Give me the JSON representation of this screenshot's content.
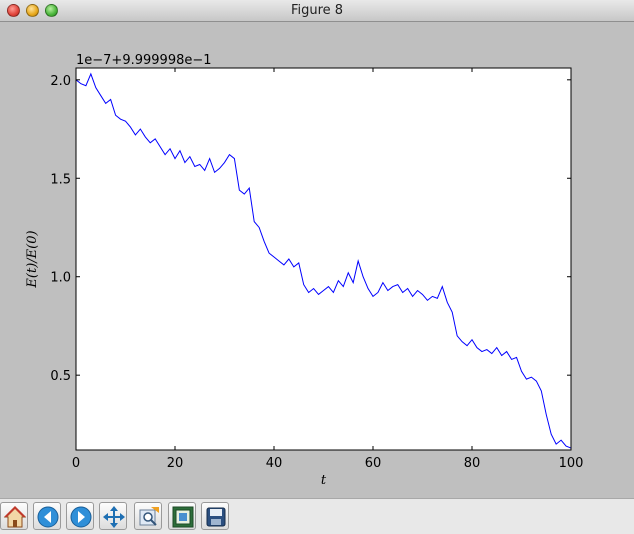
{
  "window": {
    "title": "Figure 8"
  },
  "toolbar": {
    "buttons": [
      {
        "icon": "home-icon"
      },
      {
        "icon": "back-icon"
      },
      {
        "icon": "forward-icon"
      },
      {
        "icon": "pan-icon"
      },
      {
        "icon": "zoom-rect-icon"
      },
      {
        "icon": "configure-subplots-icon"
      },
      {
        "icon": "save-icon"
      }
    ]
  },
  "colors": {
    "line": "#0000ff",
    "axes_bg": "#ffffff",
    "figure_bg": "#bfbfbf"
  },
  "chart_data": {
    "type": "line",
    "offset_label": "1e−7+9.999998e−1",
    "xlabel": "t",
    "ylabel": "E(t)/E(0)",
    "xlim": [
      0,
      100
    ],
    "ylim": [
      0.12,
      2.06
    ],
    "xticks": [
      0,
      20,
      40,
      60,
      80,
      100
    ],
    "yticks": [
      0.5,
      1.0,
      1.5,
      2.0
    ],
    "xtick_labels": [
      "0",
      "20",
      "40",
      "60",
      "80",
      "100"
    ],
    "ytick_labels": [
      "0.5",
      "1.0",
      "1.5",
      "2.0"
    ],
    "grid": false,
    "series": [
      {
        "x": [
          0,
          1,
          2,
          3,
          4,
          5,
          6,
          7,
          8,
          9,
          10,
          11,
          12,
          13,
          14,
          15,
          16,
          17,
          18,
          19,
          20,
          21,
          22,
          23,
          24,
          25,
          26,
          27,
          28,
          29,
          30,
          31,
          32,
          33,
          34,
          35,
          36,
          37,
          38,
          39,
          40,
          41,
          42,
          43,
          44,
          45,
          46,
          47,
          48,
          49,
          50,
          51,
          52,
          53,
          54,
          55,
          56,
          57,
          58,
          59,
          60,
          61,
          62,
          63,
          64,
          65,
          66,
          67,
          68,
          69,
          70,
          71,
          72,
          73,
          74,
          75,
          76,
          77,
          78,
          79,
          80,
          81,
          82,
          83,
          84,
          85,
          86,
          87,
          88,
          89,
          90,
          91,
          92,
          93,
          94,
          95,
          96,
          97,
          98,
          99,
          100
        ],
        "y": [
          2.0,
          1.98,
          1.97,
          2.03,
          1.96,
          1.92,
          1.88,
          1.9,
          1.82,
          1.8,
          1.79,
          1.76,
          1.72,
          1.75,
          1.71,
          1.68,
          1.7,
          1.66,
          1.62,
          1.65,
          1.6,
          1.64,
          1.58,
          1.61,
          1.56,
          1.57,
          1.54,
          1.6,
          1.53,
          1.55,
          1.58,
          1.62,
          1.6,
          1.44,
          1.42,
          1.45,
          1.28,
          1.25,
          1.18,
          1.12,
          1.1,
          1.08,
          1.06,
          1.09,
          1.05,
          1.07,
          0.96,
          0.92,
          0.94,
          0.91,
          0.93,
          0.95,
          0.92,
          0.98,
          0.95,
          1.02,
          0.97,
          1.08,
          1.0,
          0.94,
          0.9,
          0.92,
          0.97,
          0.93,
          0.95,
          0.96,
          0.92,
          0.94,
          0.9,
          0.93,
          0.91,
          0.88,
          0.9,
          0.89,
          0.95,
          0.87,
          0.82,
          0.7,
          0.67,
          0.65,
          0.68,
          0.64,
          0.62,
          0.63,
          0.61,
          0.64,
          0.6,
          0.62,
          0.58,
          0.59,
          0.52,
          0.48,
          0.49,
          0.47,
          0.42,
          0.3,
          0.2,
          0.15,
          0.17,
          0.14,
          0.13
        ]
      }
    ]
  }
}
